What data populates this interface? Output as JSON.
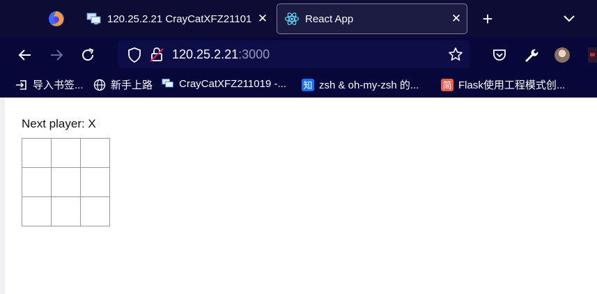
{
  "browser": {
    "tabs": [
      {
        "title": "120.25.2.21 CrayCatXFZ21101",
        "active": false,
        "icon": "remote-desktop-icon"
      },
      {
        "title": "React App",
        "active": true,
        "icon": "react-icon"
      }
    ],
    "close_glyph": "✕",
    "newtab_glyph": "+",
    "url": {
      "host": "120.25.2.21",
      "port": ":3000"
    },
    "bookmarks": [
      {
        "label": "导入书签...",
        "icon": "import-icon"
      },
      {
        "label": "新手上路",
        "icon": "globe-icon"
      },
      {
        "label": "CrayCatXFZ211019 -...",
        "icon": "remote-desktop-icon"
      },
      {
        "label": "zsh & oh-my-zsh 的...",
        "icon": "zhihu-icon",
        "badge": "知"
      },
      {
        "label": "Flask使用工程模式创...",
        "icon": "jianshu-icon",
        "badge": "简"
      }
    ]
  },
  "game": {
    "status": "Next player: X",
    "squares": [
      "",
      "",
      "",
      "",
      "",
      "",
      "",
      "",
      ""
    ]
  }
}
